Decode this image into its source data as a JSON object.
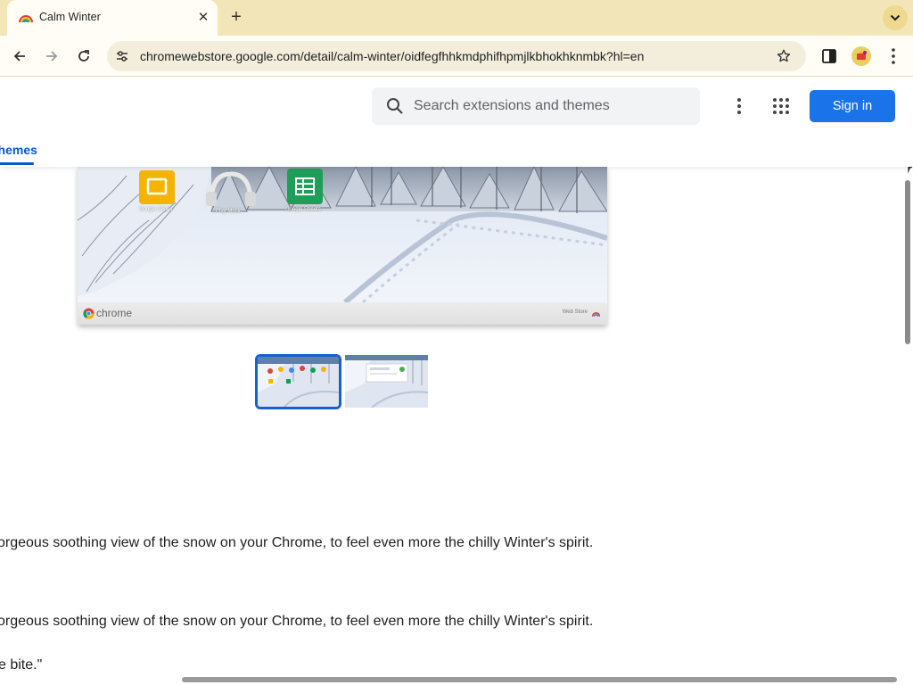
{
  "browser": {
    "tab": {
      "title": "Calm Winter",
      "close_glyph": "✕"
    },
    "new_tab_glyph": "+",
    "url": "chromewebstore.google.com/detail/calm-winter/oidfegfhhkmdphifhpmjlkbhokhknmbk?hl=en",
    "theme_colors": {
      "frame": "#f2e6b9",
      "toolbar": "#fffdf5"
    },
    "icons": [
      "rainbow-favicon-icon",
      "back-arrow-icon",
      "forward-arrow-icon",
      "reload-icon",
      "site-info-icon",
      "star-icon",
      "side-panel-icon",
      "profile-icon",
      "chrome-menu-icon",
      "tab-search-chevron-icon"
    ]
  },
  "store_header": {
    "search_placeholder": "Search extensions and themes",
    "sign_in_label": "Sign in",
    "active_nav_tab": "Themes",
    "accent_color": "#1a73e8"
  },
  "preview": {
    "shortcuts": [
      "Google Slides",
      "Play Music",
      "Google Sheets"
    ],
    "footer_brand": "chrome",
    "footer_right": "Web Store",
    "thumbnails_count": 2,
    "selected_thumbnail": 1
  },
  "description": {
    "line1": "orgeous soothing view of the snow on your Chrome, to feel even more the chilly Winter's spirit.",
    "line2": "orgeous soothing view of the snow on your Chrome, to feel even more the chilly Winter's spirit.",
    "line3": "e bite.\""
  }
}
